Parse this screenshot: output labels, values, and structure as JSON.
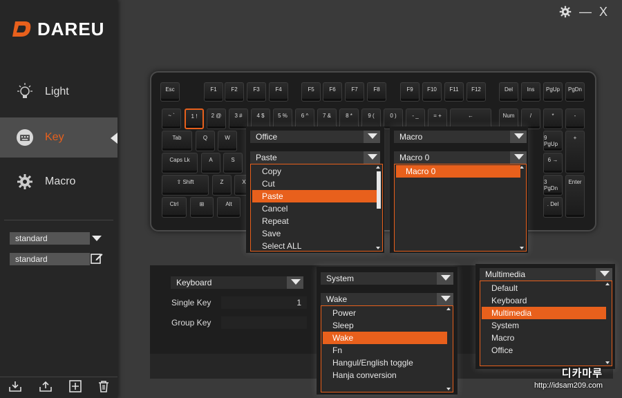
{
  "app": {
    "logo": "DAREU"
  },
  "window": {
    "minimize": "—",
    "close": "X"
  },
  "sidebar": {
    "items": [
      {
        "label": "Light",
        "icon": "bulb-icon"
      },
      {
        "label": "Key",
        "icon": "keyboard-icon",
        "active": true
      },
      {
        "label": "Macro",
        "icon": "gear-icon"
      }
    ],
    "profile_select": "standard",
    "profile_name": "standard"
  },
  "keyboard": {
    "row_fn": [
      "Esc",
      "F1",
      "F2",
      "F3",
      "F4",
      "F5",
      "F6",
      "F7",
      "F8",
      "F9",
      "F10",
      "F11",
      "F12",
      "Del",
      "Ins",
      "PgUp",
      "PgDn"
    ],
    "row_num": [
      "~ `",
      "1 !",
      "2 @",
      "3 #",
      "4 $",
      "5 %",
      "6 ^",
      "7 &",
      "8 *",
      "9 (",
      "0 )",
      "- _",
      "= +",
      "←",
      "Num",
      "/",
      "*",
      "-"
    ],
    "row_tab": [
      "Tab",
      "Q",
      "W"
    ],
    "row_caps": [
      "Caps Lk",
      "A",
      "S"
    ],
    "row_shift": [
      "⇧ Shift",
      "Z",
      "X"
    ],
    "row_ctrl": [
      "Ctrl",
      "⊞",
      "Alt"
    ],
    "numpad_right": [
      "9 PgUp",
      "+",
      "6 →",
      "3 PgDn",
      "Enter",
      ". Del"
    ]
  },
  "key_panel": {
    "category": "Office",
    "action": "Paste",
    "options": [
      "Copy",
      "Cut",
      "Paste",
      "Cancel",
      "Repeat",
      "Save",
      "Select ALL"
    ],
    "selected": "Paste"
  },
  "macro_panel": {
    "category": "Macro",
    "value": "Macro 0",
    "options": [
      "Macro 0"
    ],
    "selected": "Macro 0"
  },
  "bottom_panel": {
    "type": "Keyboard",
    "single_key_label": "Single Key",
    "single_key_value": "1",
    "group_key_label": "Group Key",
    "group_key_value": ""
  },
  "system_panel": {
    "category": "System",
    "value": "Wake",
    "options": [
      "Power",
      "Sleep",
      "Wake",
      "Fn",
      "Hangul/English toggle",
      "Hanja conversion"
    ],
    "selected": "Wake"
  },
  "type_panel": {
    "value": "Multimedia",
    "options": [
      "Default",
      "Keyboard",
      "Multimedia",
      "System",
      "Macro",
      "Office"
    ],
    "selected": "Multimedia"
  },
  "watermark": {
    "text": "http://idsam209.com",
    "brand": "디카마루"
  },
  "colors": {
    "accent": "#e8601c",
    "bg": "#3a3a3a",
    "sidebar": "#262626"
  }
}
